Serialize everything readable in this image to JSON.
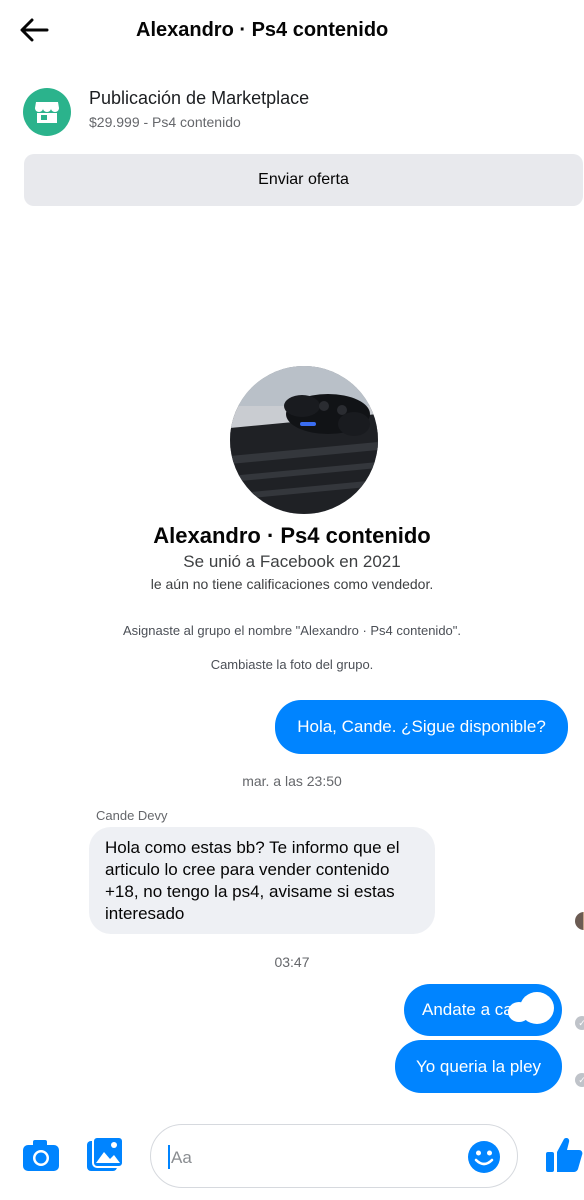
{
  "header": {
    "title": "Alexandro · Ps4 contenido"
  },
  "listing": {
    "title": "Publicación de Marketplace",
    "subtitle": "$29.999 - Ps4 contenido",
    "offer_button": "Enviar oferta"
  },
  "profile": {
    "name": "Alexandro · Ps4 contenido",
    "joined": "Se unió a Facebook en 2021",
    "rating": "le aún no tiene calificaciones como vendedor."
  },
  "system_messages": [
    "Asignaste al grupo el nombre \"Alexandro · Ps4 contenido\".",
    "Cambiaste la foto del grupo."
  ],
  "messages": {
    "out_1": "Hola, Cande. ¿Sigue disponible?",
    "time_1": "mar. a las 23:50",
    "sender": "Cande Devy",
    "in_1": "Hola como estas bb? Te informo que el articulo lo cree para vender contenido +18, no tengo la ps4, avisame si estas interesado",
    "time_2": "03:47",
    "out_2": "Andate a ca",
    "out_3": "Yo queria la pley"
  },
  "composer": {
    "placeholder": "Aa"
  },
  "icons": [
    "back-arrow-icon",
    "store-icon",
    "camera-icon",
    "gallery-icon",
    "emoji-icon",
    "thumbs-up-icon",
    "seen-check-icon"
  ],
  "colors": {
    "accent": "#0084ff",
    "marketplace": "#2bb38c",
    "incoming_bubble": "#eef0f4"
  }
}
